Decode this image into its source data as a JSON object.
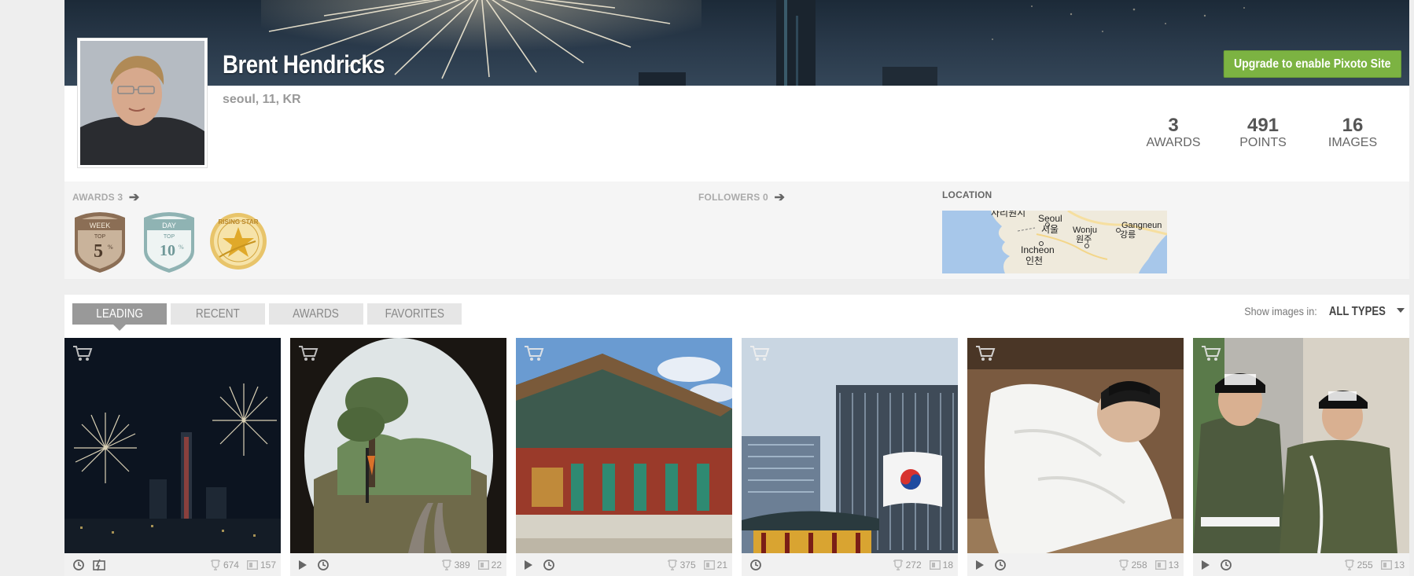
{
  "profile": {
    "name": "Brent Hendricks",
    "location": "seoul, 11, KR",
    "upgrade_label": "Upgrade to enable Pixoto Site"
  },
  "stats": [
    {
      "value": "3",
      "label": "AWARDS"
    },
    {
      "value": "491",
      "label": "POINTS"
    },
    {
      "value": "16",
      "label": "IMAGES"
    }
  ],
  "info": {
    "awards_label": "AWARDS",
    "awards_count": "3",
    "followers_label": "FOLLOWERS",
    "followers_count": "0",
    "location_label": "LOCATION"
  },
  "badges": [
    {
      "top": "WEEK",
      "mid": "TOP",
      "value": "5",
      "color": "#a08770"
    },
    {
      "top": "DAY",
      "mid": "TOP",
      "value": "10",
      "color": "#8fb3b3"
    },
    {
      "top": "RISING STAR",
      "mid": "",
      "value": "",
      "color": "#e0b13c"
    }
  ],
  "map_labels": {
    "seoul_en": "Seoul",
    "seoul_ko": "서울",
    "incheon_en": "Incheon",
    "incheon_ko": "인천",
    "wonju_en": "Wonju",
    "wonju_ko": "원주",
    "gangneung_en": "Gangneun",
    "gangneung_ko": "강릉",
    "top_ko": "사리원시"
  },
  "tabs": [
    {
      "label": "LEADING",
      "active": true
    },
    {
      "label": "RECENT",
      "active": false
    },
    {
      "label": "AWARDS",
      "active": false
    },
    {
      "label": "FAVORITES",
      "active": false
    }
  ],
  "filter": {
    "label": "Show images in:",
    "value": "ALL TYPES"
  },
  "images": [
    {
      "votes": "674",
      "views": "157"
    },
    {
      "votes": "389",
      "views": "22"
    },
    {
      "votes": "375",
      "views": "21"
    },
    {
      "votes": "272",
      "views": "18"
    },
    {
      "votes": "258",
      "views": "13"
    },
    {
      "votes": "255",
      "views": "13"
    }
  ],
  "colors": {
    "upgrade": "#7cb342",
    "tab_active": "#999999",
    "tab_inactive": "#e6e6e6"
  }
}
